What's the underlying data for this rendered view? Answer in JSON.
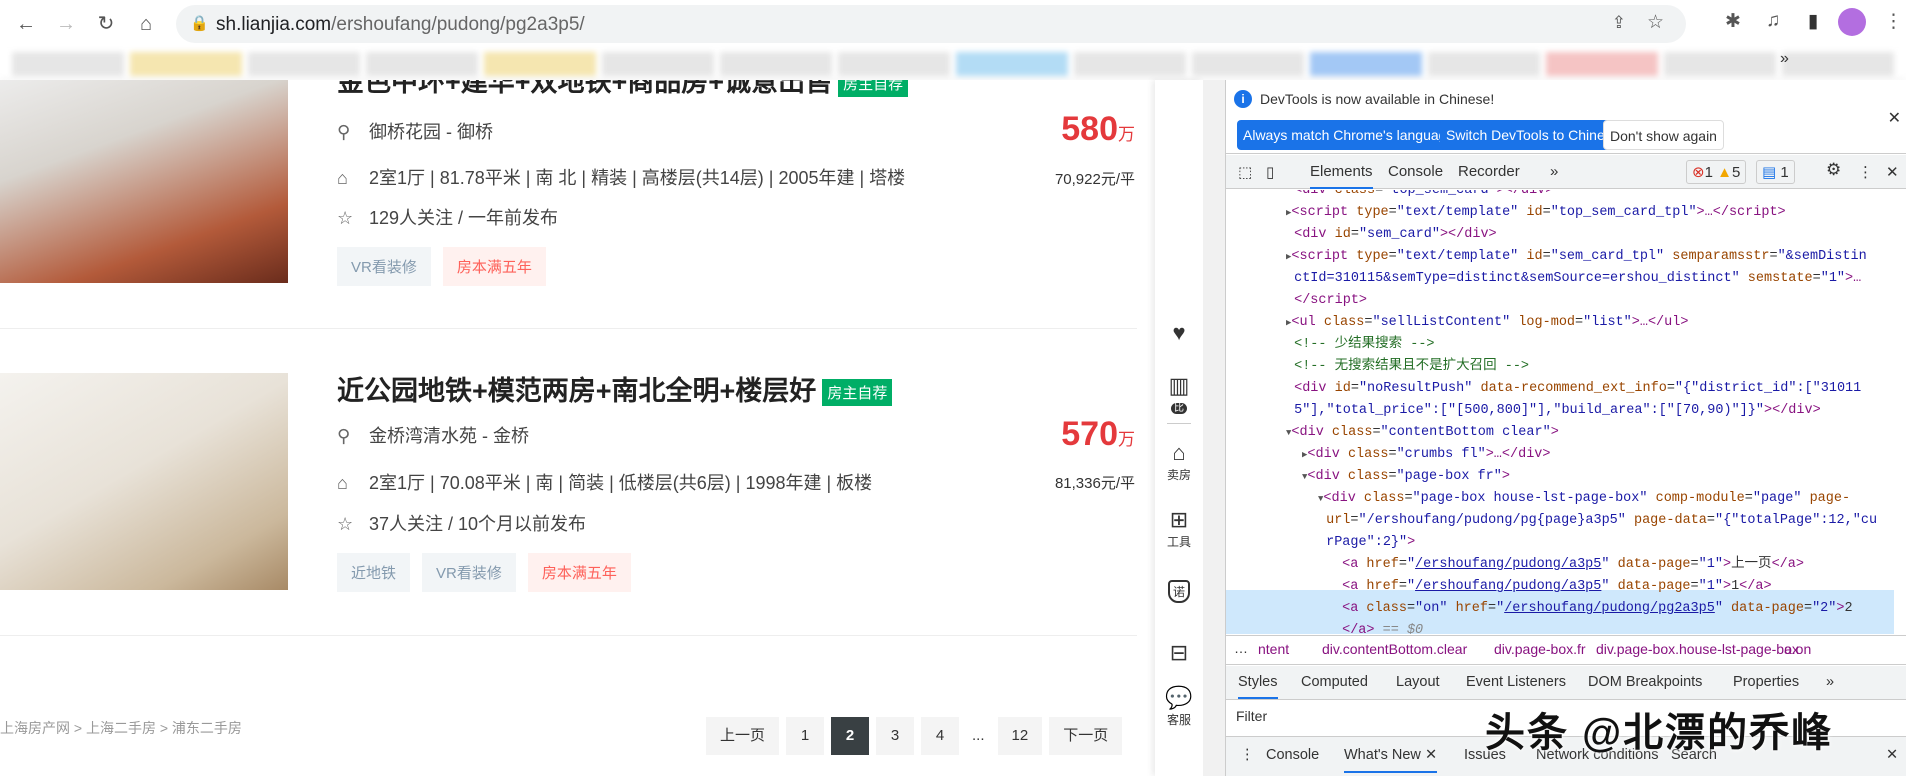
{
  "browser": {
    "url_host": "sh.lianjia.com",
    "url_path": "/ershoufang/pudong/pg2a3p5/",
    "bookmark_overflow": "»"
  },
  "listings": [
    {
      "title": "金色中环+建华+双地铁+商品房+诚意出售",
      "badge": "房主自荐",
      "location": "御桥花园 - 御桥",
      "info": "2室1厅 | 81.78平米 | 南 北 | 精装 | 高楼层(共14层) | 2005年建 | 塔楼",
      "follow": "129人关注 / 一年前发布",
      "tags": [
        "VR看装修",
        "房本满五年"
      ],
      "price": "580",
      "price_unit": "万",
      "unit_price": "70,922元/平"
    },
    {
      "title": "近公园地铁+模范两房+南北全明+楼层好",
      "badge": "房主自荐",
      "location": "金桥湾清水苑 - 金桥",
      "info": "2室1厅 | 70.08平米 | 南 | 简装 | 低楼层(共6层) | 1998年建 | 板楼",
      "follow": "37人关注 / 10个月以前发布",
      "tags": [
        "近地铁",
        "VR看装修",
        "房本满五年"
      ],
      "price": "570",
      "price_unit": "万",
      "unit_price": "81,336元/平"
    }
  ],
  "breadcrumb": "上海房产网 > 上海二手房 > 浦东二手房",
  "pagination": {
    "prev": "上一页",
    "pages": [
      "1",
      "2",
      "3",
      "4",
      "...",
      "12"
    ],
    "current": "2",
    "next": "下一页"
  },
  "sidebar": {
    "sell": "卖房",
    "tools": "工具",
    "service": "客服",
    "compare_badge": "比",
    "promise_badge": "诺"
  },
  "devtools": {
    "info": "DevTools is now available in Chinese!",
    "btn_match": "Always match Chrome's language",
    "btn_switch": "Switch DevTools to Chinese",
    "btn_dont": "Don't show again",
    "tabs": [
      "Elements",
      "Console",
      "Recorder",
      "»"
    ],
    "errors": "1",
    "warnings": "5",
    "messages": "1",
    "breadcrumbs": [
      "ntent",
      "div.contentBottom.clear",
      "div.page-box.fr",
      "div.page-box.house-lst-page-box",
      "a.on"
    ],
    "style_tabs": [
      "Styles",
      "Computed",
      "Layout",
      "Event Listeners",
      "DOM Breakpoints",
      "Properties",
      "»"
    ],
    "filter": "Filter",
    "drawer_tabs": [
      "Console",
      "What's New",
      "Issues",
      "Network conditions",
      "Search"
    ]
  },
  "watermark": "头条 @北漂的乔峰"
}
